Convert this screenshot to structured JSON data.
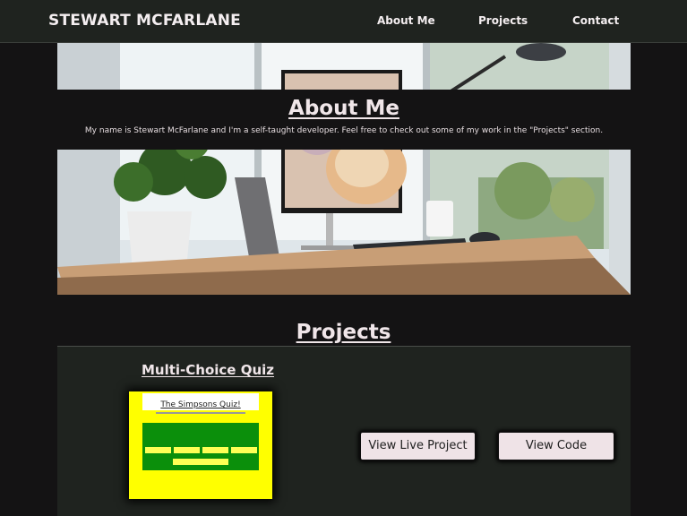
{
  "navbar": {
    "brand": "STEWART MCFARLANE",
    "links": [
      {
        "label": "About Me"
      },
      {
        "label": "Projects"
      },
      {
        "label": "Contact"
      }
    ]
  },
  "about": {
    "title": "About Me",
    "text": "My name is Stewart McFarlane and I'm a self-taught developer. Feel free to check out some of my work in the \"Projects\" section."
  },
  "projects": {
    "heading": "Projects",
    "items": [
      {
        "title": "Multi-Choice Quiz",
        "thumbnail": {
          "title": "The Simpsons Quiz!"
        },
        "live_label": "View Live Project",
        "code_label": "View Code"
      }
    ]
  },
  "colors": {
    "page_bg": "#141314",
    "navbar_bg": "#1f231f",
    "text": "#f0e6e9",
    "button_bg": "#efe3e7",
    "thumb_bg": "#ffff00",
    "thumb_green": "#0b8f0b"
  },
  "icons": []
}
